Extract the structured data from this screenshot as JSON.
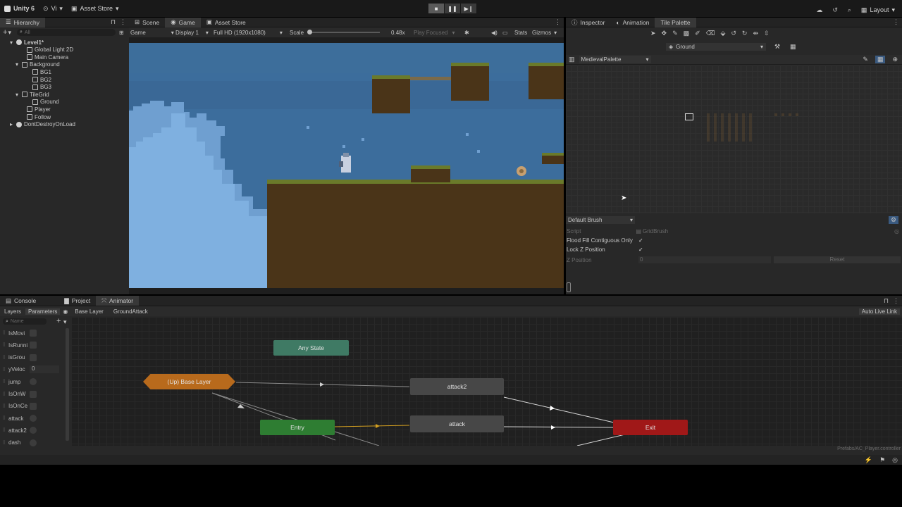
{
  "app": {
    "account_label": "Unity 6",
    "vc_label": "Vi",
    "asset_store_label": "Asset Store",
    "layout_label": "Layout"
  },
  "hierarchy": {
    "tab_label": "Hierarchy",
    "search_placeholder": "All",
    "items": [
      {
        "label": "Level1*",
        "indent": 0
      },
      {
        "label": "Global Light 2D",
        "indent": 2
      },
      {
        "label": "Main Camera",
        "indent": 2
      },
      {
        "label": "Background",
        "indent": 1
      },
      {
        "label": "BG1",
        "indent": 3
      },
      {
        "label": "BG2",
        "indent": 3
      },
      {
        "label": "BG3",
        "indent": 3
      },
      {
        "label": "TileGrid",
        "indent": 1
      },
      {
        "label": "Ground",
        "indent": 3
      },
      {
        "label": "Player",
        "indent": 2
      },
      {
        "label": "Follow",
        "indent": 2
      },
      {
        "label": "DontDestroyOnLoad",
        "indent": 0
      }
    ]
  },
  "center_tabs": [
    {
      "label": "Scene"
    },
    {
      "label": "Game"
    },
    {
      "label": "Asset Store"
    }
  ],
  "gamebar": {
    "mode": "Game",
    "display": "Display 1",
    "resolution": "Full HD (1920x1080)",
    "scale_label": "Scale",
    "scale_value": "0.48x",
    "play_focused": "Play Focused",
    "stats": "Stats",
    "gizmos": "Gizmos",
    "scale_fraction": 0.0
  },
  "right_tabs": [
    {
      "label": "Inspector"
    },
    {
      "label": "Animation"
    },
    {
      "label": "Tile Palette"
    }
  ],
  "tile_palette": {
    "target": "Ground",
    "palette": "MedievalPalette",
    "brush": "Default Brush",
    "script_label": "Script",
    "script_value": "GridBrush",
    "flood_fill_label": "Flood Fill Contiguous Only",
    "lock_z_label": "Lock Z Position",
    "z_position_label": "Z Position",
    "z_position_value": "0",
    "reset_label": "Reset"
  },
  "bottom_tabs": [
    {
      "label": "Console"
    },
    {
      "label": "Project"
    },
    {
      "label": "Animator"
    }
  ],
  "animator": {
    "layers_label": "Layers",
    "parameters_label": "Parameters",
    "breadcrumb_base": "Base Layer",
    "breadcrumb_sub": "GroundAttack",
    "auto_live_link": "Auto Live Link",
    "name_placeholder": "Name",
    "parameters": [
      {
        "name": "IsMovi",
        "type": "bool",
        "value": ""
      },
      {
        "name": "IsRunni",
        "type": "bool",
        "value": ""
      },
      {
        "name": "isGrou",
        "type": "bool",
        "value": ""
      },
      {
        "name": "yVeloc",
        "type": "float",
        "value": "0"
      },
      {
        "name": "jump",
        "type": "trigger",
        "value": ""
      },
      {
        "name": "IsOnW",
        "type": "bool",
        "value": ""
      },
      {
        "name": "IsOnCe",
        "type": "bool",
        "value": ""
      },
      {
        "name": "attack",
        "type": "trigger",
        "value": ""
      },
      {
        "name": "attack2",
        "type": "trigger",
        "value": ""
      },
      {
        "name": "dash",
        "type": "trigger",
        "value": ""
      }
    ],
    "nodes": {
      "any_state": "Any State",
      "up_base_layer": "(Up) Base Layer",
      "attack2": "attack2",
      "entry": "Entry",
      "attack": "attack",
      "exit": "Exit"
    },
    "controller_path": "Prefabs/AC_Player.controller"
  },
  "colors": {
    "any_state": "#3f7a64",
    "up_base": "#b86a1c",
    "entry": "#2e7d32",
    "exit": "#a01818",
    "state": "#4a4a4a"
  }
}
